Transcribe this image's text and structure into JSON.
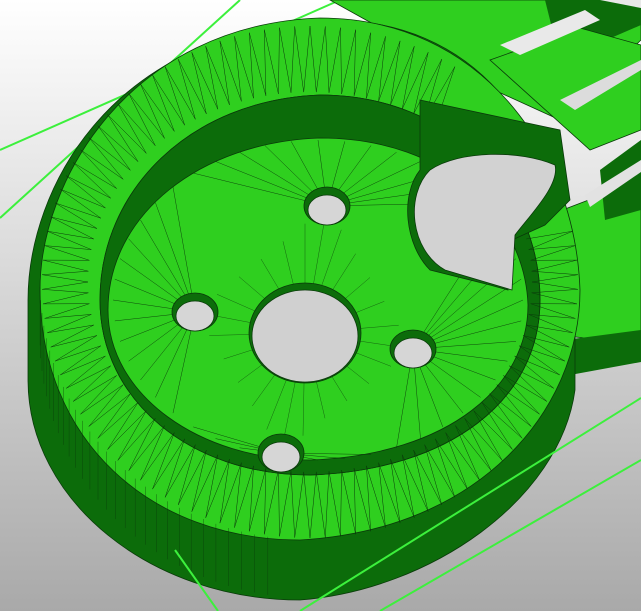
{
  "viewport": {
    "background_top": "#ffffff",
    "background_bottom": "#a9a9a9"
  },
  "model": {
    "type": "triangulated-mesh",
    "part": "motor-mount-arm",
    "face_color": "#2fcf1f",
    "face_color_light": "#38d626",
    "wall_color": "#0c6c0a",
    "wall_color_dark": "#085608",
    "edge_color": "#0a3a0a",
    "guide_line_color": "#3cf03c",
    "holes": {
      "center_bore_count": 1,
      "mounting_hole_count": 4,
      "cutout_count": 1
    }
  }
}
